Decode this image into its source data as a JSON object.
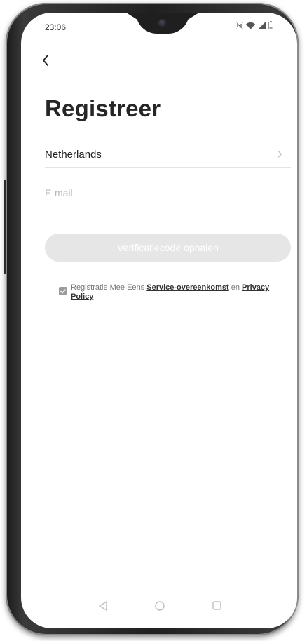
{
  "status_bar": {
    "time": "23:06",
    "icons": [
      "nfc-icon",
      "wifi-icon",
      "signal-icon",
      "battery-icon"
    ]
  },
  "header": {
    "back_icon": "chevron-left-icon",
    "title": "Registreer"
  },
  "form": {
    "country": "Netherlands",
    "country_chevron_icon": "chevron-right-icon",
    "email_value": "",
    "email_placeholder": "E-mail",
    "verify_button_label": "Verificatiecode ophalen",
    "verify_button_enabled": false
  },
  "agreement": {
    "checked": true,
    "prefix": "Registratie Mee Eens",
    "service_link": "Service-overeenkomst",
    "conjunction": "en",
    "privacy_link": "Privacy Policy"
  },
  "nav_bar": {
    "icons": [
      "back-triangle-icon",
      "home-circle-icon",
      "recents-square-icon"
    ]
  },
  "colors": {
    "button_disabled": "#e6e6e6",
    "title_text": "#262626",
    "divider": "#e3e3e3",
    "checkbox": "#9b9b9b"
  }
}
